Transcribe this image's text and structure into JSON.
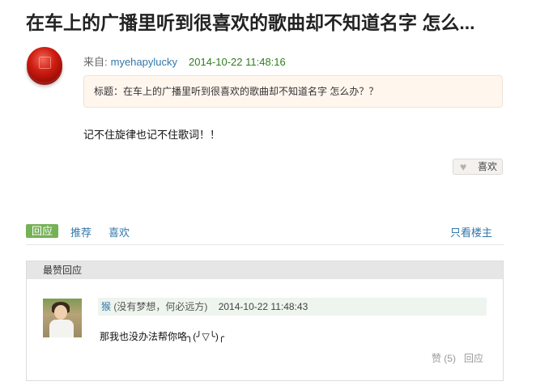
{
  "topic": {
    "title": "在车上的广播里听到很喜欢的歌曲却不知道名字 怎么..."
  },
  "post": {
    "from_label": "来自:",
    "author": "myehapylucky",
    "time": "2014-10-22 11:48:16",
    "quote": "标题：在车上的广播里听到很喜欢的歌曲却不知道名字 怎么办？？",
    "body": "记不住旋律也记不住歌词！！",
    "like_label": "喜欢",
    "icons": {
      "avatar": "red-button-avatar",
      "like": "heart-icon"
    }
  },
  "actions": {
    "reply": "回应",
    "recommend": "推荐",
    "favorite": "喜欢",
    "owner_only": "只看楼主"
  },
  "best": {
    "header": "最赞回应",
    "comment": {
      "name": "猴",
      "subtitle": "(没有梦想，何必远方)",
      "time": "2014-10-22 11:48:43",
      "text": "那我也没办法帮你咯╮(╯▽╰)╭",
      "likes": "赞 (5)",
      "reply": "回应"
    }
  },
  "colors": {
    "link": "#3377aa",
    "time_green": "#2f7d1f",
    "reply_tab_bg": "#75b156",
    "quote_bg": "#fff6ee"
  }
}
